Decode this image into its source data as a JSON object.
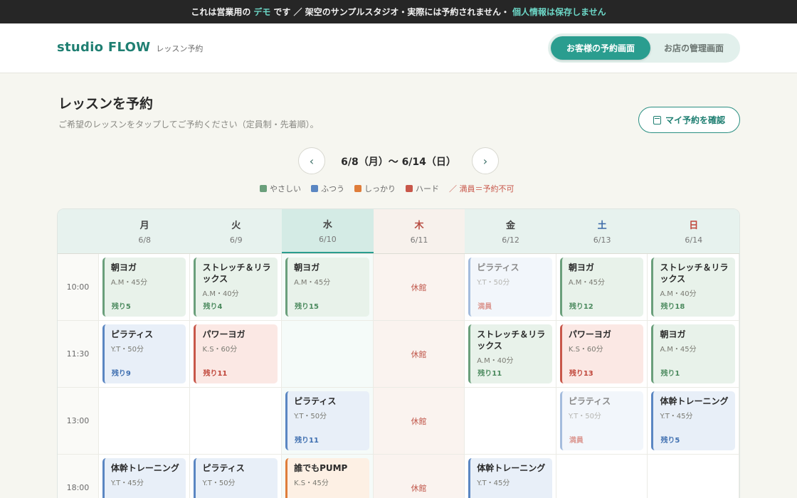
{
  "banner": {
    "part1": "これは営業用の",
    "demo": "デモ",
    "part2": "です ／ 架空のサンプルスタジオ・実際には予約されません・",
    "privacy": "個人情報は保存しません"
  },
  "header": {
    "brand": "studio FLOW",
    "subtitle": "レッスン予約",
    "customer_tab": "お客様の予約画面",
    "admin_tab": "お店の管理画面"
  },
  "page": {
    "title": "レッスンを予約",
    "description": "ご希望のレッスンをタップしてご予約ください（定員制・先着順）。",
    "my_reservation": "マイ予約を確認"
  },
  "week_nav": {
    "prev": "‹",
    "next": "›",
    "label": "6/8（月）〜 6/14（日）"
  },
  "legend": {
    "items": [
      {
        "label": "やさしい",
        "color": "#6a9f7b"
      },
      {
        "label": "ふつう",
        "color": "#5a86c2"
      },
      {
        "label": "しっかり",
        "color": "#df7d3a"
      },
      {
        "label": "ハード",
        "color": "#c8574a"
      }
    ],
    "note": "／ 満員＝予約不可"
  },
  "days": [
    {
      "name": "月",
      "date": "6/8",
      "kind": ""
    },
    {
      "name": "火",
      "date": "6/9",
      "kind": ""
    },
    {
      "name": "水",
      "date": "6/10",
      "kind": "today"
    },
    {
      "name": "木",
      "date": "6/11",
      "kind": "closed"
    },
    {
      "name": "金",
      "date": "6/12",
      "kind": ""
    },
    {
      "name": "土",
      "date": "6/13",
      "kind": "sat"
    },
    {
      "name": "日",
      "date": "6/14",
      "kind": "sun"
    }
  ],
  "closed_text": "休館",
  "rows": [
    {
      "time": "10:00",
      "cells": [
        {
          "name": "朝ヨガ",
          "info": "A.M・45分",
          "remain": "残り5",
          "level": "green"
        },
        {
          "name": "ストレッチ＆リラックス",
          "info": "A.M・40分",
          "remain": "残り4",
          "level": "green"
        },
        {
          "name": "朝ヨガ",
          "info": "A.M・45分",
          "remain": "残り15",
          "level": "green"
        },
        {
          "closed": true
        },
        {
          "name": "ピラティス",
          "info": "Y.T・50分",
          "remain": "満員",
          "level": "blue",
          "full": true
        },
        {
          "name": "朝ヨガ",
          "info": "A.M・45分",
          "remain": "残り12",
          "level": "green"
        },
        {
          "name": "ストレッチ＆リラックス",
          "info": "A.M・40分",
          "remain": "残り18",
          "level": "green"
        }
      ]
    },
    {
      "time": "11:30",
      "cells": [
        {
          "name": "ピラティス",
          "info": "Y.T・50分",
          "remain": "残り9",
          "level": "blue"
        },
        {
          "name": "パワーヨガ",
          "info": "K.S・60分",
          "remain": "残り11",
          "level": "red"
        },
        null,
        {
          "closed": true
        },
        {
          "name": "ストレッチ＆リラックス",
          "info": "A.M・40分",
          "remain": "残り11",
          "level": "green"
        },
        {
          "name": "パワーヨガ",
          "info": "K.S・60分",
          "remain": "残り13",
          "level": "red"
        },
        {
          "name": "朝ヨガ",
          "info": "A.M・45分",
          "remain": "残り1",
          "level": "green"
        }
      ]
    },
    {
      "time": "13:00",
      "cells": [
        null,
        null,
        {
          "name": "ピラティス",
          "info": "Y.T・50分",
          "remain": "残り11",
          "level": "blue"
        },
        {
          "closed": true
        },
        null,
        {
          "name": "ピラティス",
          "info": "Y.T・50分",
          "remain": "満員",
          "level": "blue",
          "full": true
        },
        {
          "name": "体幹トレーニング",
          "info": "Y.T・45分",
          "remain": "残り5",
          "level": "blue"
        }
      ]
    },
    {
      "time": "18:00",
      "cells": [
        {
          "name": "体幹トレーニング",
          "info": "Y.T・45分",
          "remain": "",
          "level": "blue"
        },
        {
          "name": "ピラティス",
          "info": "Y.T・50分",
          "remain": "",
          "level": "blue"
        },
        {
          "name": "誰でもPUMP",
          "info": "K.S・45分",
          "remain": "",
          "level": "orange"
        },
        {
          "closed": true
        },
        {
          "name": "体幹トレーニング",
          "info": "Y.T・45分",
          "remain": "",
          "level": "blue"
        },
        null,
        null
      ]
    }
  ]
}
